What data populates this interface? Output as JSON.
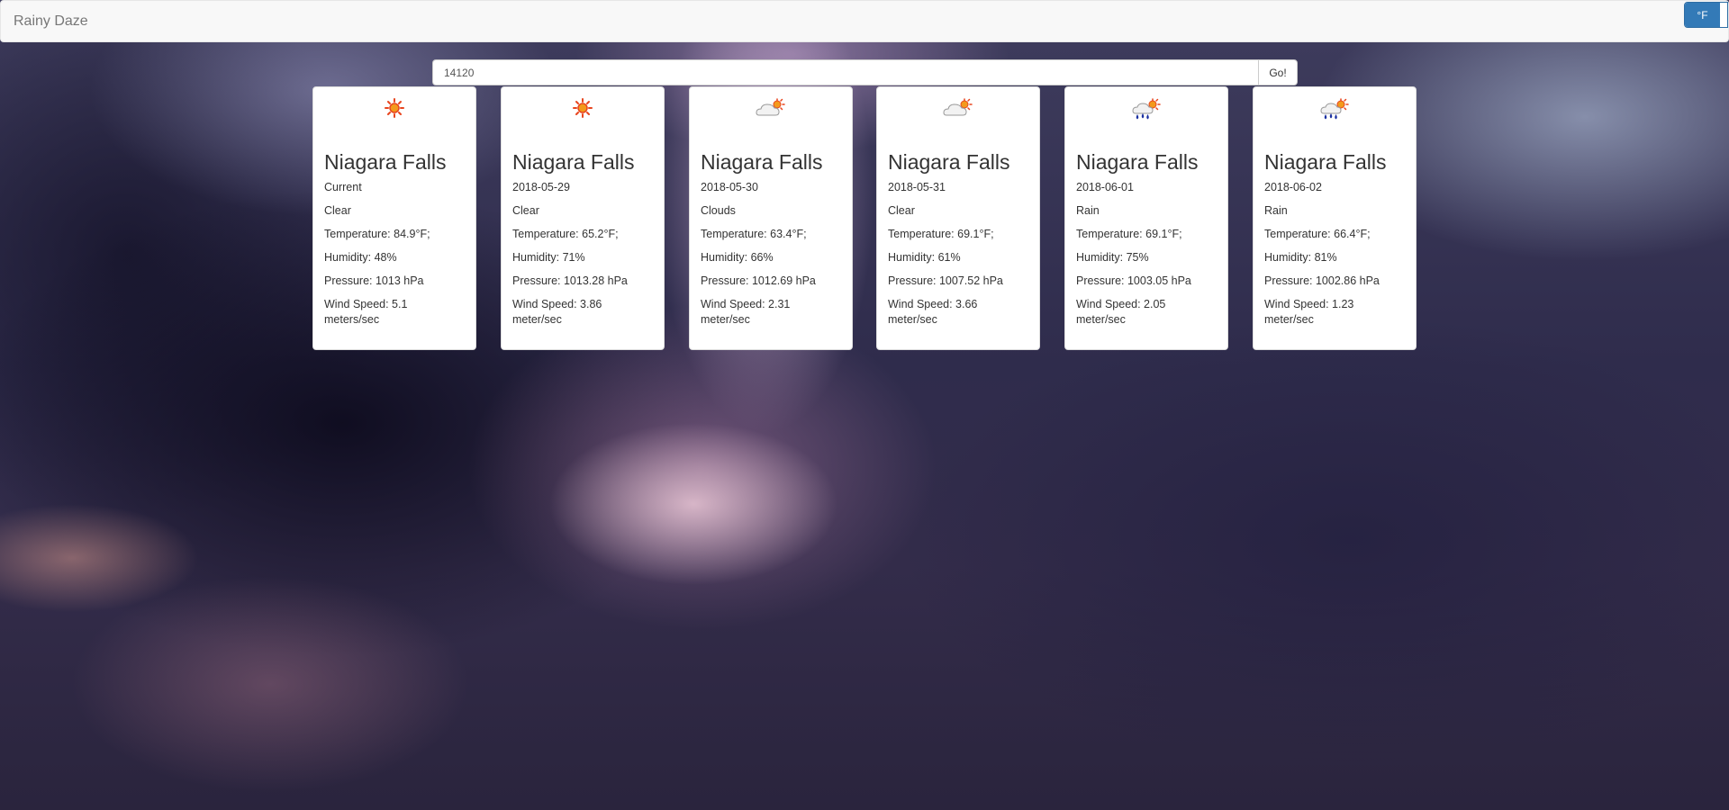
{
  "navbar": {
    "brand": "Rainy Daze",
    "unit_label": "°F"
  },
  "search": {
    "value": "14120",
    "button_label": "Go!"
  },
  "cards": [
    {
      "icon": "sun-icon",
      "city": "Niagara Falls",
      "date": "Current",
      "condition": "Clear",
      "temperature": "Temperature: 84.9°F;",
      "humidity": "Humidity: 48%",
      "pressure": "Pressure: 1013 hPa",
      "wind": "Wind Speed: 5.1 meters/sec"
    },
    {
      "icon": "sun-icon",
      "city": "Niagara Falls",
      "date": "2018-05-29",
      "condition": "Clear",
      "temperature": "Temperature: 65.2°F;",
      "humidity": "Humidity: 71%",
      "pressure": "Pressure: 1013.28 hPa",
      "wind": "Wind Speed: 3.86 meter/sec"
    },
    {
      "icon": "cloud-sun-icon",
      "city": "Niagara Falls",
      "date": "2018-05-30",
      "condition": "Clouds",
      "temperature": "Temperature: 63.4°F;",
      "humidity": "Humidity: 66%",
      "pressure": "Pressure: 1012.69 hPa",
      "wind": "Wind Speed: 2.31 meter/sec"
    },
    {
      "icon": "cloud-sun-icon",
      "city": "Niagara Falls",
      "date": "2018-05-31",
      "condition": "Clear",
      "temperature": "Temperature: 69.1°F;",
      "humidity": "Humidity: 61%",
      "pressure": "Pressure: 1007.52 hPa",
      "wind": "Wind Speed: 3.66 meter/sec"
    },
    {
      "icon": "rain-sun-icon",
      "city": "Niagara Falls",
      "date": "2018-06-01",
      "condition": "Rain",
      "temperature": "Temperature: 69.1°F;",
      "humidity": "Humidity: 75%",
      "pressure": "Pressure: 1003.05 hPa",
      "wind": "Wind Speed: 2.05 meter/sec"
    },
    {
      "icon": "rain-sun-icon",
      "city": "Niagara Falls",
      "date": "2018-06-02",
      "condition": "Rain",
      "temperature": "Temperature: 66.4°F;",
      "humidity": "Humidity: 81%",
      "pressure": "Pressure: 1002.86 hPa",
      "wind": "Wind Speed: 1.23 meter/sec"
    }
  ]
}
